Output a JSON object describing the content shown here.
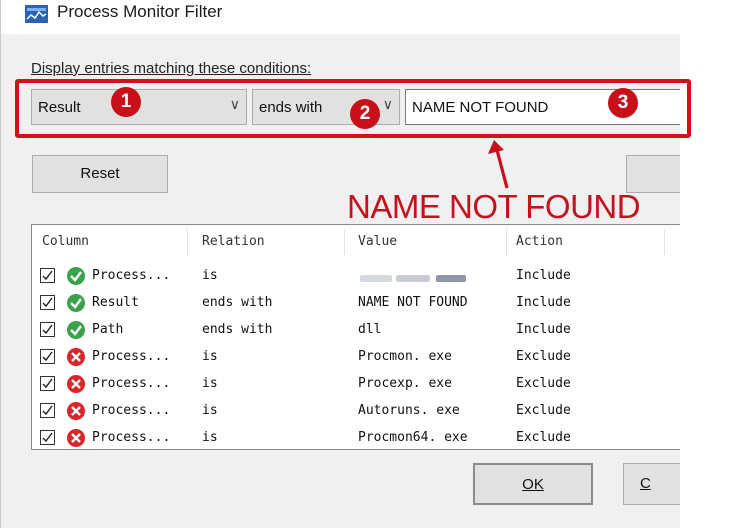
{
  "window": {
    "title": "Process Monitor Filter"
  },
  "conditions_label": "Display entries matching these conditions:",
  "filter": {
    "column": "Result",
    "relation": "ends with",
    "value": "NAME NOT FOUND",
    "reset_label": "Reset"
  },
  "annotations": {
    "badge1": "1",
    "badge2": "2",
    "badge3": "3",
    "callout": "NAME NOT FOUND",
    "highlight_color": "#d0121b"
  },
  "table": {
    "headers": [
      "Column",
      "Relation",
      "Value",
      "Action"
    ],
    "rows": [
      {
        "column": "Process...",
        "relation": "is",
        "value": "",
        "action": "Include",
        "status": "include-icon",
        "value_redacted": true
      },
      {
        "column": "Result",
        "relation": "ends with",
        "value": "NAME NOT FOUND",
        "action": "Include",
        "status": "include-icon"
      },
      {
        "column": "Path",
        "relation": "ends with",
        "value": "dll",
        "action": "Include",
        "status": "include-icon"
      },
      {
        "column": "Process...",
        "relation": "is",
        "value": "Procmon. exe",
        "action": "Exclude",
        "status": "exclude-icon"
      },
      {
        "column": "Process...",
        "relation": "is",
        "value": "Procexp. exe",
        "action": "Exclude",
        "status": "exclude-icon"
      },
      {
        "column": "Process...",
        "relation": "is",
        "value": "Autoruns. exe",
        "action": "Exclude",
        "status": "exclude-icon"
      },
      {
        "column": "Process...",
        "relation": "is",
        "value": "Procmon64. exe",
        "action": "Exclude",
        "status": "exclude-icon"
      }
    ]
  },
  "buttons": {
    "ok": "OK",
    "cancel_partial": "C"
  },
  "colors": {
    "include": "#3aa24a",
    "exclude": "#d8262b",
    "title_icon": "#2a62b8"
  }
}
